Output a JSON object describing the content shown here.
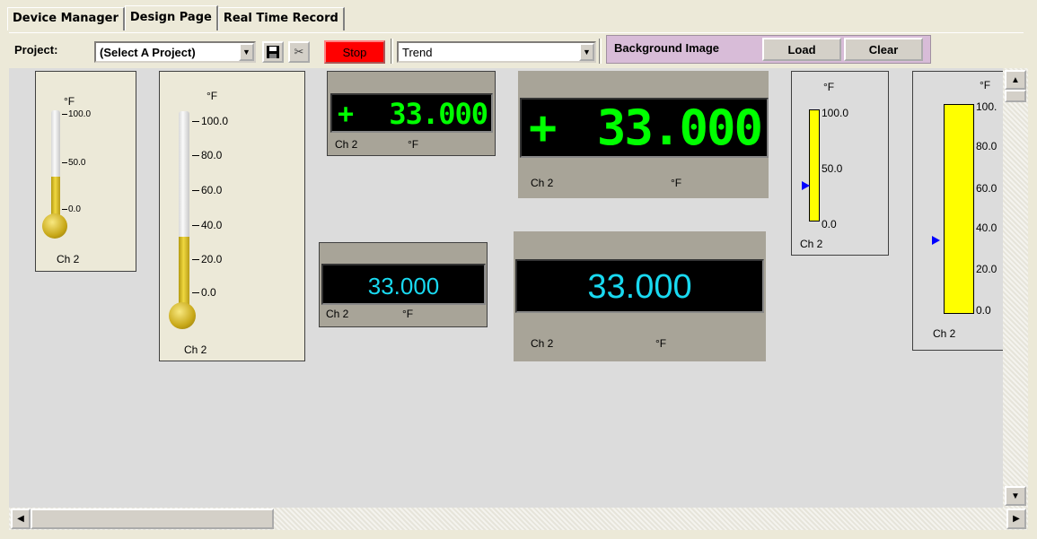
{
  "tabs": [
    {
      "label": "Device Manager"
    },
    {
      "label": "Design Page"
    },
    {
      "label": "Real Time Record"
    }
  ],
  "toolbar": {
    "project_label": "Project:",
    "project_select": "(Select A Project)",
    "stop_label": "Stop",
    "view_select": "Trend",
    "background_label": "Background Image",
    "load_label": "Load",
    "clear_label": "Clear"
  },
  "widgets": {
    "therm_small": {
      "unit": "°F",
      "channel": "Ch 2",
      "ticks": [
        "100.0",
        "50.0",
        "0.0"
      ],
      "value": 33.0
    },
    "therm_large": {
      "unit": "°F",
      "channel": "Ch 2",
      "ticks": [
        "100.0",
        "80.0",
        "60.0",
        "40.0",
        "20.0",
        "0.0"
      ],
      "value": 33.0
    },
    "seg_small": {
      "sign": "+",
      "value": "33.000",
      "channel": "Ch 2",
      "unit": "°F"
    },
    "seg_large": {
      "sign": "+",
      "value": "33.000",
      "channel": "Ch 2",
      "unit": "°F"
    },
    "digital_small": {
      "value": "33.000",
      "channel": "Ch 2",
      "unit": "°F"
    },
    "digital_large": {
      "value": "33.000",
      "channel": "Ch 2",
      "unit": "°F"
    },
    "bar_small": {
      "unit": "°F",
      "channel": "Ch 2",
      "ticks": [
        "100.0",
        "50.0",
        "0.0"
      ],
      "value": 33.0
    },
    "bar_large": {
      "unit": "°F",
      "channel": "Ch 2",
      "ticks": [
        "100.",
        "80.0",
        "60.0",
        "40.0",
        "20.0",
        "0.0"
      ],
      "value": 33.0
    }
  },
  "colors": {
    "stop": "#ff0000",
    "lcd_green": "#00ff00",
    "lcd_cyan": "#19d9f0",
    "bar_yellow": "#ffff00",
    "pointer_blue": "#0000ff"
  }
}
